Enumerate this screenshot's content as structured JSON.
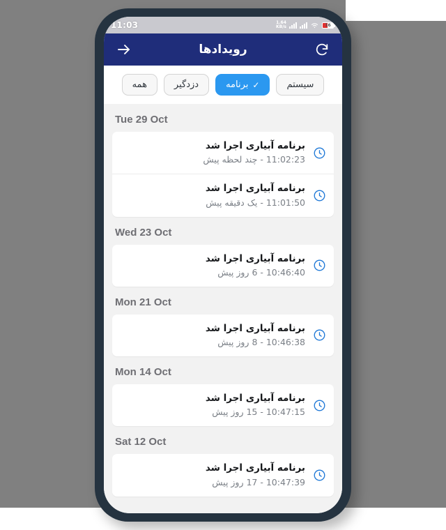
{
  "status_bar": {
    "time": "11:03",
    "net_rate_value": "1.64",
    "net_rate_unit": "KB/s",
    "battery_level": "16",
    "icons": [
      "signal-bars-icon",
      "signal-bars-icon",
      "wifi-icon",
      "battery-icon"
    ]
  },
  "header": {
    "title": "رویدادها",
    "refresh_icon": "refresh-icon",
    "back_icon": "arrow-right-icon",
    "background_color": "#1f2d7a"
  },
  "filters": {
    "accent_color": "#2b98f0",
    "chips": [
      {
        "label": "سیستم",
        "active": false
      },
      {
        "label": "برنامه",
        "active": true,
        "check": "✓"
      },
      {
        "label": "دزدگیر",
        "active": false
      },
      {
        "label": "همه",
        "active": false
      }
    ]
  },
  "events": {
    "icon": "clock-icon",
    "icon_color": "#1e78d7",
    "groups": [
      {
        "date": "Tue 29 Oct",
        "items": [
          {
            "title": "برنامه آبیاری اجرا شد",
            "subtitle": "11:02:23 - چند لحظه پیش"
          },
          {
            "title": "برنامه آبیاری اجرا شد",
            "subtitle": "11:01:50 - یک دقیقه پیش"
          }
        ]
      },
      {
        "date": "Wed 23 Oct",
        "items": [
          {
            "title": "برنامه آبیاری اجرا شد",
            "subtitle": "10:46:40 - 6 روز پیش"
          }
        ]
      },
      {
        "date": "Mon 21 Oct",
        "items": [
          {
            "title": "برنامه آبیاری اجرا شد",
            "subtitle": "10:46:38 - 8 روز پیش"
          }
        ]
      },
      {
        "date": "Mon 14 Oct",
        "items": [
          {
            "title": "برنامه آبیاری اجرا شد",
            "subtitle": "10:47:15 - 15 روز پیش"
          }
        ]
      },
      {
        "date": "Sat 12 Oct",
        "items": [
          {
            "title": "برنامه آبیاری اجرا شد",
            "subtitle": "10:47:39 - 17 روز پیش"
          }
        ]
      }
    ]
  }
}
